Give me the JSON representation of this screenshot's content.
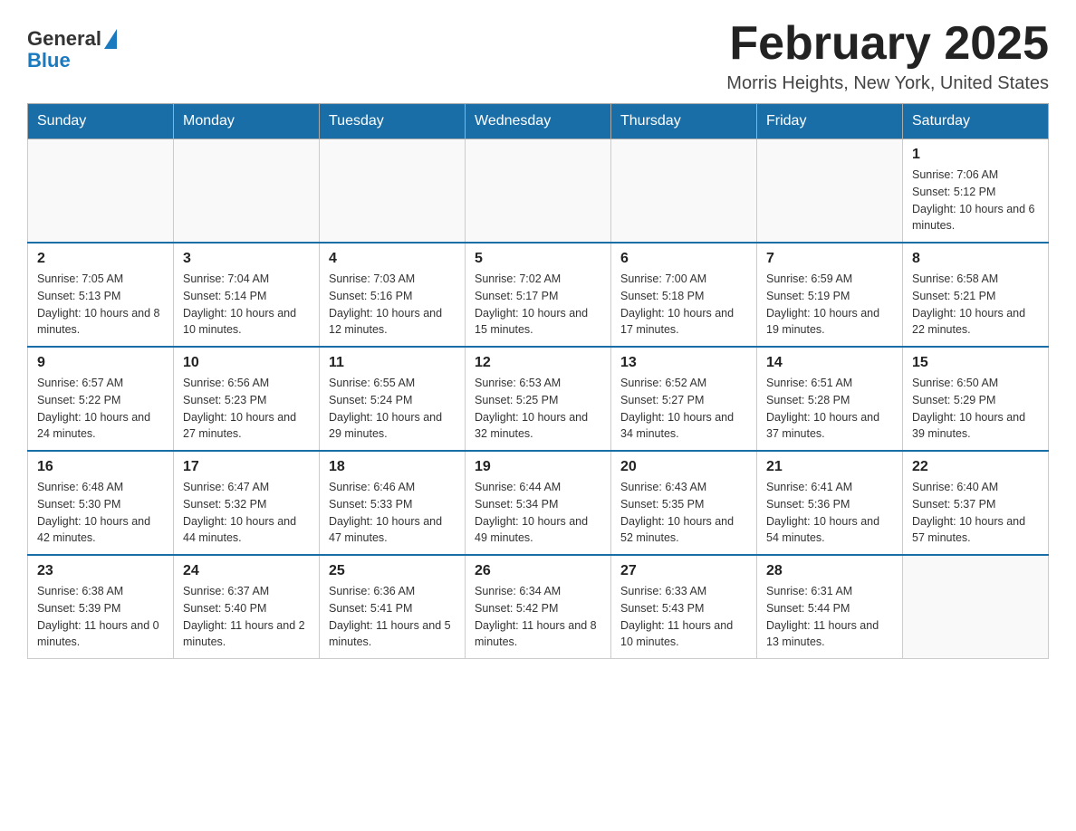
{
  "logo": {
    "general": "General",
    "blue": "Blue"
  },
  "title": "February 2025",
  "location": "Morris Heights, New York, United States",
  "weekdays": [
    "Sunday",
    "Monday",
    "Tuesday",
    "Wednesday",
    "Thursday",
    "Friday",
    "Saturday"
  ],
  "weeks": [
    [
      {
        "day": "",
        "info": ""
      },
      {
        "day": "",
        "info": ""
      },
      {
        "day": "",
        "info": ""
      },
      {
        "day": "",
        "info": ""
      },
      {
        "day": "",
        "info": ""
      },
      {
        "day": "",
        "info": ""
      },
      {
        "day": "1",
        "info": "Sunrise: 7:06 AM\nSunset: 5:12 PM\nDaylight: 10 hours and 6 minutes."
      }
    ],
    [
      {
        "day": "2",
        "info": "Sunrise: 7:05 AM\nSunset: 5:13 PM\nDaylight: 10 hours and 8 minutes."
      },
      {
        "day": "3",
        "info": "Sunrise: 7:04 AM\nSunset: 5:14 PM\nDaylight: 10 hours and 10 minutes."
      },
      {
        "day": "4",
        "info": "Sunrise: 7:03 AM\nSunset: 5:16 PM\nDaylight: 10 hours and 12 minutes."
      },
      {
        "day": "5",
        "info": "Sunrise: 7:02 AM\nSunset: 5:17 PM\nDaylight: 10 hours and 15 minutes."
      },
      {
        "day": "6",
        "info": "Sunrise: 7:00 AM\nSunset: 5:18 PM\nDaylight: 10 hours and 17 minutes."
      },
      {
        "day": "7",
        "info": "Sunrise: 6:59 AM\nSunset: 5:19 PM\nDaylight: 10 hours and 19 minutes."
      },
      {
        "day": "8",
        "info": "Sunrise: 6:58 AM\nSunset: 5:21 PM\nDaylight: 10 hours and 22 minutes."
      }
    ],
    [
      {
        "day": "9",
        "info": "Sunrise: 6:57 AM\nSunset: 5:22 PM\nDaylight: 10 hours and 24 minutes."
      },
      {
        "day": "10",
        "info": "Sunrise: 6:56 AM\nSunset: 5:23 PM\nDaylight: 10 hours and 27 minutes."
      },
      {
        "day": "11",
        "info": "Sunrise: 6:55 AM\nSunset: 5:24 PM\nDaylight: 10 hours and 29 minutes."
      },
      {
        "day": "12",
        "info": "Sunrise: 6:53 AM\nSunset: 5:25 PM\nDaylight: 10 hours and 32 minutes."
      },
      {
        "day": "13",
        "info": "Sunrise: 6:52 AM\nSunset: 5:27 PM\nDaylight: 10 hours and 34 minutes."
      },
      {
        "day": "14",
        "info": "Sunrise: 6:51 AM\nSunset: 5:28 PM\nDaylight: 10 hours and 37 minutes."
      },
      {
        "day": "15",
        "info": "Sunrise: 6:50 AM\nSunset: 5:29 PM\nDaylight: 10 hours and 39 minutes."
      }
    ],
    [
      {
        "day": "16",
        "info": "Sunrise: 6:48 AM\nSunset: 5:30 PM\nDaylight: 10 hours and 42 minutes."
      },
      {
        "day": "17",
        "info": "Sunrise: 6:47 AM\nSunset: 5:32 PM\nDaylight: 10 hours and 44 minutes."
      },
      {
        "day": "18",
        "info": "Sunrise: 6:46 AM\nSunset: 5:33 PM\nDaylight: 10 hours and 47 minutes."
      },
      {
        "day": "19",
        "info": "Sunrise: 6:44 AM\nSunset: 5:34 PM\nDaylight: 10 hours and 49 minutes."
      },
      {
        "day": "20",
        "info": "Sunrise: 6:43 AM\nSunset: 5:35 PM\nDaylight: 10 hours and 52 minutes."
      },
      {
        "day": "21",
        "info": "Sunrise: 6:41 AM\nSunset: 5:36 PM\nDaylight: 10 hours and 54 minutes."
      },
      {
        "day": "22",
        "info": "Sunrise: 6:40 AM\nSunset: 5:37 PM\nDaylight: 10 hours and 57 minutes."
      }
    ],
    [
      {
        "day": "23",
        "info": "Sunrise: 6:38 AM\nSunset: 5:39 PM\nDaylight: 11 hours and 0 minutes."
      },
      {
        "day": "24",
        "info": "Sunrise: 6:37 AM\nSunset: 5:40 PM\nDaylight: 11 hours and 2 minutes."
      },
      {
        "day": "25",
        "info": "Sunrise: 6:36 AM\nSunset: 5:41 PM\nDaylight: 11 hours and 5 minutes."
      },
      {
        "day": "26",
        "info": "Sunrise: 6:34 AM\nSunset: 5:42 PM\nDaylight: 11 hours and 8 minutes."
      },
      {
        "day": "27",
        "info": "Sunrise: 6:33 AM\nSunset: 5:43 PM\nDaylight: 11 hours and 10 minutes."
      },
      {
        "day": "28",
        "info": "Sunrise: 6:31 AM\nSunset: 5:44 PM\nDaylight: 11 hours and 13 minutes."
      },
      {
        "day": "",
        "info": ""
      }
    ]
  ]
}
